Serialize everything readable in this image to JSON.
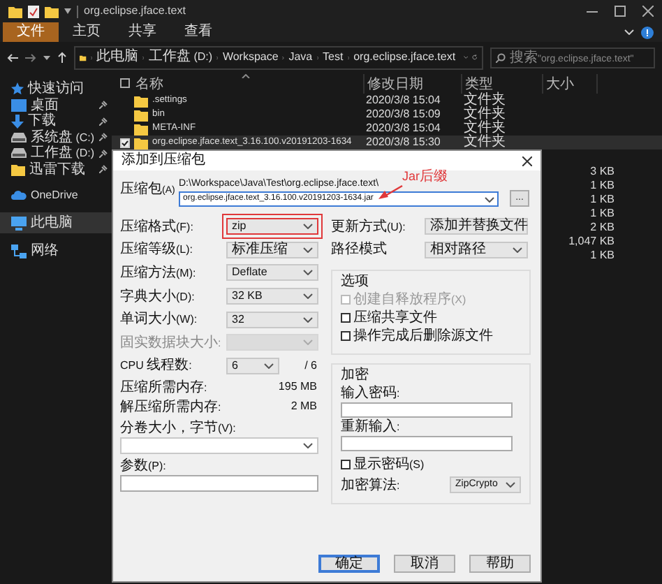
{
  "window": {
    "title": "org.eclipse.jface.text"
  },
  "ribbon_tabs": [
    {
      "label": "文件",
      "selected": true
    },
    {
      "label": "主页",
      "selected": false
    },
    {
      "label": "共享",
      "selected": false
    },
    {
      "label": "查看",
      "selected": false
    }
  ],
  "address": {
    "crumbs": [
      "此电脑",
      "工作盘 (D:)",
      "Workspace",
      "Java",
      "Test",
      "org.eclipse.jface.text"
    ]
  },
  "search": {
    "placeholder": "搜索\"org.eclipse.jface.text\""
  },
  "sidebar": {
    "sections": [
      {
        "items": [
          {
            "label": "快速访问",
            "kind": "star",
            "pinned": false,
            "selected": false
          },
          {
            "label": "桌面",
            "kind": "desktop",
            "pinned": true,
            "selected": false
          },
          {
            "label": "下载",
            "kind": "download",
            "pinned": true,
            "selected": false
          },
          {
            "label": "系统盘 (C:)",
            "kind": "drive",
            "pinned": true,
            "selected": false
          },
          {
            "label": "工作盘 (D:)",
            "kind": "drive",
            "pinned": true,
            "selected": false
          },
          {
            "label": "迅雷下载",
            "kind": "folder",
            "pinned": true,
            "selected": false
          }
        ]
      },
      {
        "items": [
          {
            "label": "OneDrive",
            "kind": "cloud",
            "pinned": false,
            "selected": false
          }
        ]
      },
      {
        "items": [
          {
            "label": "此电脑",
            "kind": "pc",
            "pinned": false,
            "selected": true
          }
        ]
      },
      {
        "items": [
          {
            "label": "网络",
            "kind": "network",
            "pinned": false,
            "selected": false
          }
        ]
      }
    ]
  },
  "files": {
    "columns": [
      "名称",
      "修改日期",
      "类型",
      "大小"
    ],
    "rows": [
      {
        "name": ".settings",
        "date": "2020/3/8 15:04",
        "type": "文件夹",
        "selected": false
      },
      {
        "name": "bin",
        "date": "2020/3/8 15:09",
        "type": "文件夹",
        "selected": false
      },
      {
        "name": "META-INF",
        "date": "2020/3/8 15:04",
        "type": "文件夹",
        "selected": false
      },
      {
        "name": "org.eclipse.jface.text_3.16.100.v20191203-1634",
        "date": "2020/3/8 15:30",
        "type": "文件夹",
        "selected": true
      }
    ],
    "covered_rows": [
      {
        "size": "3 KB"
      },
      {
        "size": "1 KB"
      },
      {
        "size": "1 KB"
      },
      {
        "size": "1 KB"
      },
      {
        "size": "2 KB"
      },
      {
        "size": "1,047 KB"
      },
      {
        "size": "1 KB"
      }
    ]
  },
  "dialog": {
    "title": "添加到压缩包",
    "archive": {
      "label": "压缩包(A)",
      "path": "D:\\Workspace\\Java\\Test\\org.eclipse.jface.text\\",
      "value": "org.eclipse.jface.text_3.16.100.v20191203-1634.jar",
      "browse": "..."
    },
    "annotation": {
      "text": "Jar后缀"
    },
    "left_fields": [
      {
        "label": "压缩格式(F):",
        "kind": "combo",
        "value": "zip",
        "highlighted": true,
        "disabled": false
      },
      {
        "label": "压缩等级(L):",
        "kind": "combo",
        "value": "标准压缩",
        "highlighted": false,
        "disabled": false
      },
      {
        "label": "压缩方法(M):",
        "kind": "combo",
        "value": "Deflate",
        "highlighted": false,
        "disabled": false
      },
      {
        "label": "字典大小(D):",
        "kind": "combo",
        "value": "32 KB",
        "highlighted": false,
        "disabled": false
      },
      {
        "label": "单词大小(W):",
        "kind": "combo",
        "value": "32",
        "highlighted": false,
        "disabled": false
      },
      {
        "label": "固实数据块大小:",
        "kind": "combo",
        "highlighted": false,
        "disabled": true
      },
      {
        "label": "CPU 线程数:",
        "kind": "threads",
        "value": "6",
        "total": "/ 6",
        "highlighted": false,
        "disabled": false
      },
      {
        "label": "压缩所需内存:",
        "kind": "reading",
        "value": "195 MB",
        "highlighted": false,
        "disabled": false
      },
      {
        "label": "解压缩所需内存:",
        "kind": "reading",
        "value": "2 MB",
        "highlighted": false,
        "disabled": false
      },
      {
        "label": "分卷大小，字节(V):",
        "kind": "stacked-combo",
        "highlighted": false,
        "disabled": false
      },
      {
        "label": "参数(P):",
        "kind": "stacked-input",
        "highlighted": false,
        "disabled": false
      }
    ],
    "right_fields": [
      {
        "label": "更新方式(U):",
        "value": "添加并替换文件"
      },
      {
        "label": "路径模式",
        "value": "相对路径"
      }
    ],
    "options": {
      "title": "选项",
      "items": [
        {
          "label": "创建自释放程序(X)",
          "checked": false,
          "disabled": true
        },
        {
          "label": "压缩共享文件",
          "checked": false,
          "disabled": false
        },
        {
          "label": "操作完成后删除源文件",
          "checked": false,
          "disabled": false
        }
      ]
    },
    "encryption": {
      "title": "加密",
      "password_label": "输入密码:",
      "repeat_label": "重新输入:",
      "show_password": {
        "label": "显示密码(S)",
        "checked": false
      },
      "method_label": "加密算法:",
      "method": "ZipCrypto"
    },
    "buttons": [
      {
        "label": "确定",
        "default": true
      },
      {
        "label": "取消",
        "default": false
      },
      {
        "label": "帮助",
        "default": false
      }
    ]
  }
}
